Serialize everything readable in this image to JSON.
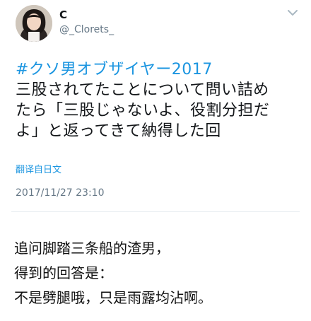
{
  "tweet": {
    "display_name": "C",
    "handle": "@_Clorets_",
    "hashtag": "#クソ男オブザイヤー2017",
    "body_lines": [
      "三股されてたことについて問い詰め",
      "たら「三股じゃないよ、役割分担だ",
      "よ」と返ってきて納得した回"
    ],
    "translate_label": "翻译自日文",
    "timestamp": "2017/11/27 23:10",
    "menu_icon": "chevron-down-icon",
    "colors": {
      "link": "#1b95e0",
      "secondary": "#657786",
      "text": "#14171a"
    }
  },
  "caption": {
    "lines": [
      "追问脚踏三条船的渣男，",
      "得到的回答是：",
      "不是劈腿哦，只是雨露均沾啊。"
    ]
  }
}
